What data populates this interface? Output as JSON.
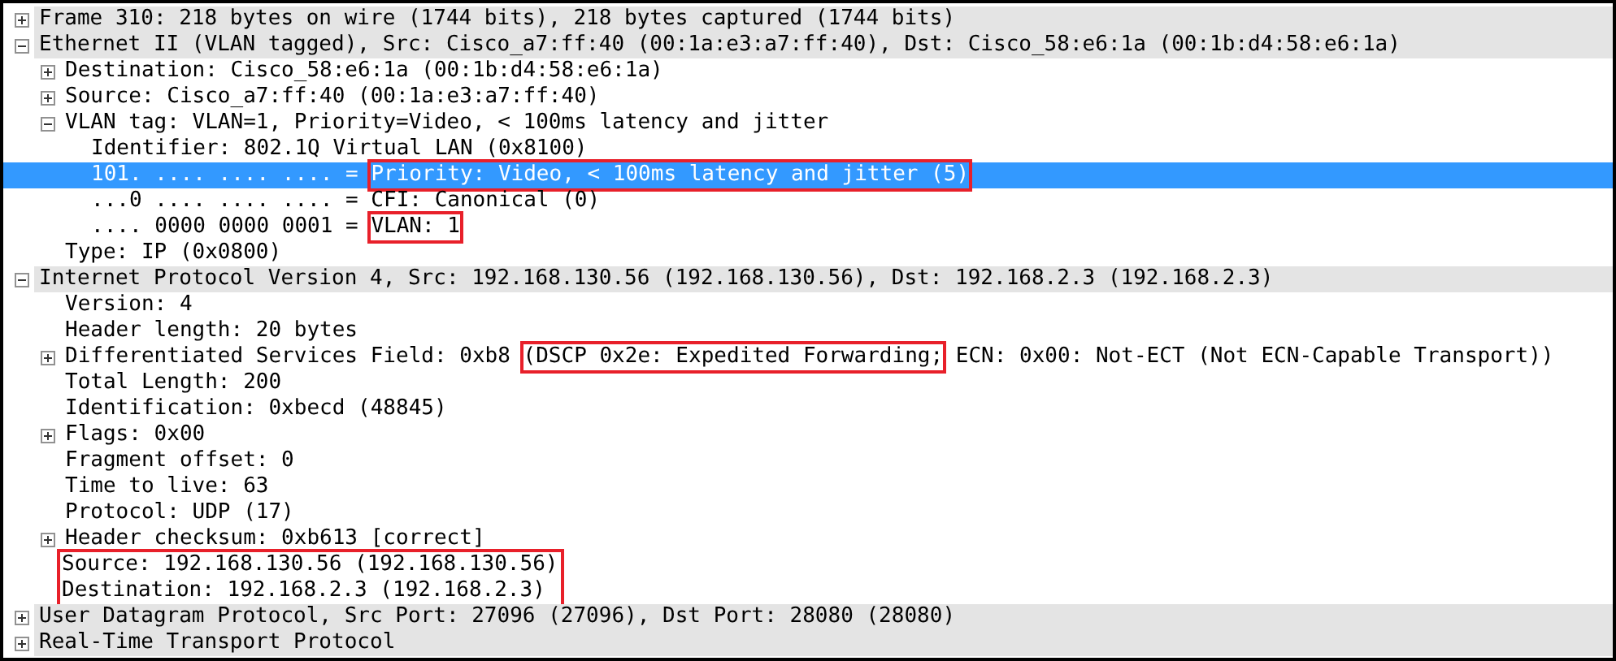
{
  "tree": [
    {
      "label": "Frame 310: 218 bytes on wire (1744 bits), 218 bytes captured (1744 bits)",
      "expanded": false,
      "selected": false
    },
    {
      "label": "Ethernet II (VLAN tagged), Src: Cisco_a7:ff:40 (00:1a:e3:a7:ff:40), Dst: Cisco_58:e6:1a (00:1b:d4:58:e6:1a)",
      "expanded": true,
      "selected": false,
      "children": [
        {
          "label": "Destination: Cisco_58:e6:1a (00:1b:d4:58:e6:1a)",
          "expanded": false,
          "selected": false
        },
        {
          "label": "Source: Cisco_a7:ff:40 (00:1a:e3:a7:ff:40)",
          "expanded": false,
          "selected": false
        },
        {
          "label": "VLAN tag: VLAN=1, Priority=Video, < 100ms latency and jitter",
          "expanded": true,
          "selected": false,
          "children": [
            {
              "label": "Identifier: 802.1Q Virtual LAN (0x8100)",
              "selected": false
            },
            {
              "parts": [
                {
                  "text": "101. .... .... .... = ",
                  "boxed": false
                },
                {
                  "text": "Priority: Video, < 100ms latency and jitter (5)",
                  "boxed": true
                }
              ],
              "selected": true
            },
            {
              "label": "...0 .... .... .... = CFI: Canonical (0)",
              "selected": false
            },
            {
              "parts": [
                {
                  "text": ".... 0000 0000 0001 = ",
                  "boxed": false
                },
                {
                  "text": "VLAN: 1",
                  "boxed": true
                }
              ],
              "selected": false
            }
          ]
        },
        {
          "label": "Type: IP (0x0800)",
          "selected": false
        }
      ]
    },
    {
      "label": "Internet Protocol Version 4, Src: 192.168.130.56 (192.168.130.56), Dst: 192.168.2.3 (192.168.2.3)",
      "expanded": true,
      "selected": false,
      "children": [
        {
          "label": "Version: 4",
          "selected": false
        },
        {
          "label": "Header length: 20 bytes",
          "selected": false
        },
        {
          "parts": [
            {
              "text": "Differentiated Services Field: 0xb8 ",
              "boxed": false
            },
            {
              "text": "(DSCP 0x2e: Expedited Forwarding;",
              "boxed": true
            },
            {
              "text": " ECN: 0x00: Not-ECT (Not ECN-Capable Transport))",
              "boxed": false
            }
          ],
          "expanded": false,
          "selected": false
        },
        {
          "label": "Total Length: 200",
          "selected": false
        },
        {
          "label": "Identification: 0xbecd (48845)",
          "selected": false
        },
        {
          "label": "Flags: 0x00",
          "expanded": false,
          "selected": false
        },
        {
          "label": "Fragment offset: 0",
          "selected": false
        },
        {
          "label": "Time to live: 63",
          "selected": false
        },
        {
          "label": "Protocol: UDP (17)",
          "selected": false
        },
        {
          "label": "Header checksum: 0xb613 [correct]",
          "expanded": false,
          "selected": false
        },
        {
          "label": "Source: 192.168.130.56 (192.168.130.56)",
          "selected": false,
          "boxed": true
        },
        {
          "label": "Destination: 192.168.2.3 (192.168.2.3)",
          "selected": false,
          "boxed": true
        }
      ]
    },
    {
      "label": "User Datagram Protocol, Src Port: 27096 (27096), Dst Port: 28080 (28080)",
      "expanded": false,
      "selected": false
    },
    {
      "label": "Real-Time Transport Protocol",
      "expanded": false,
      "selected": false
    }
  ]
}
